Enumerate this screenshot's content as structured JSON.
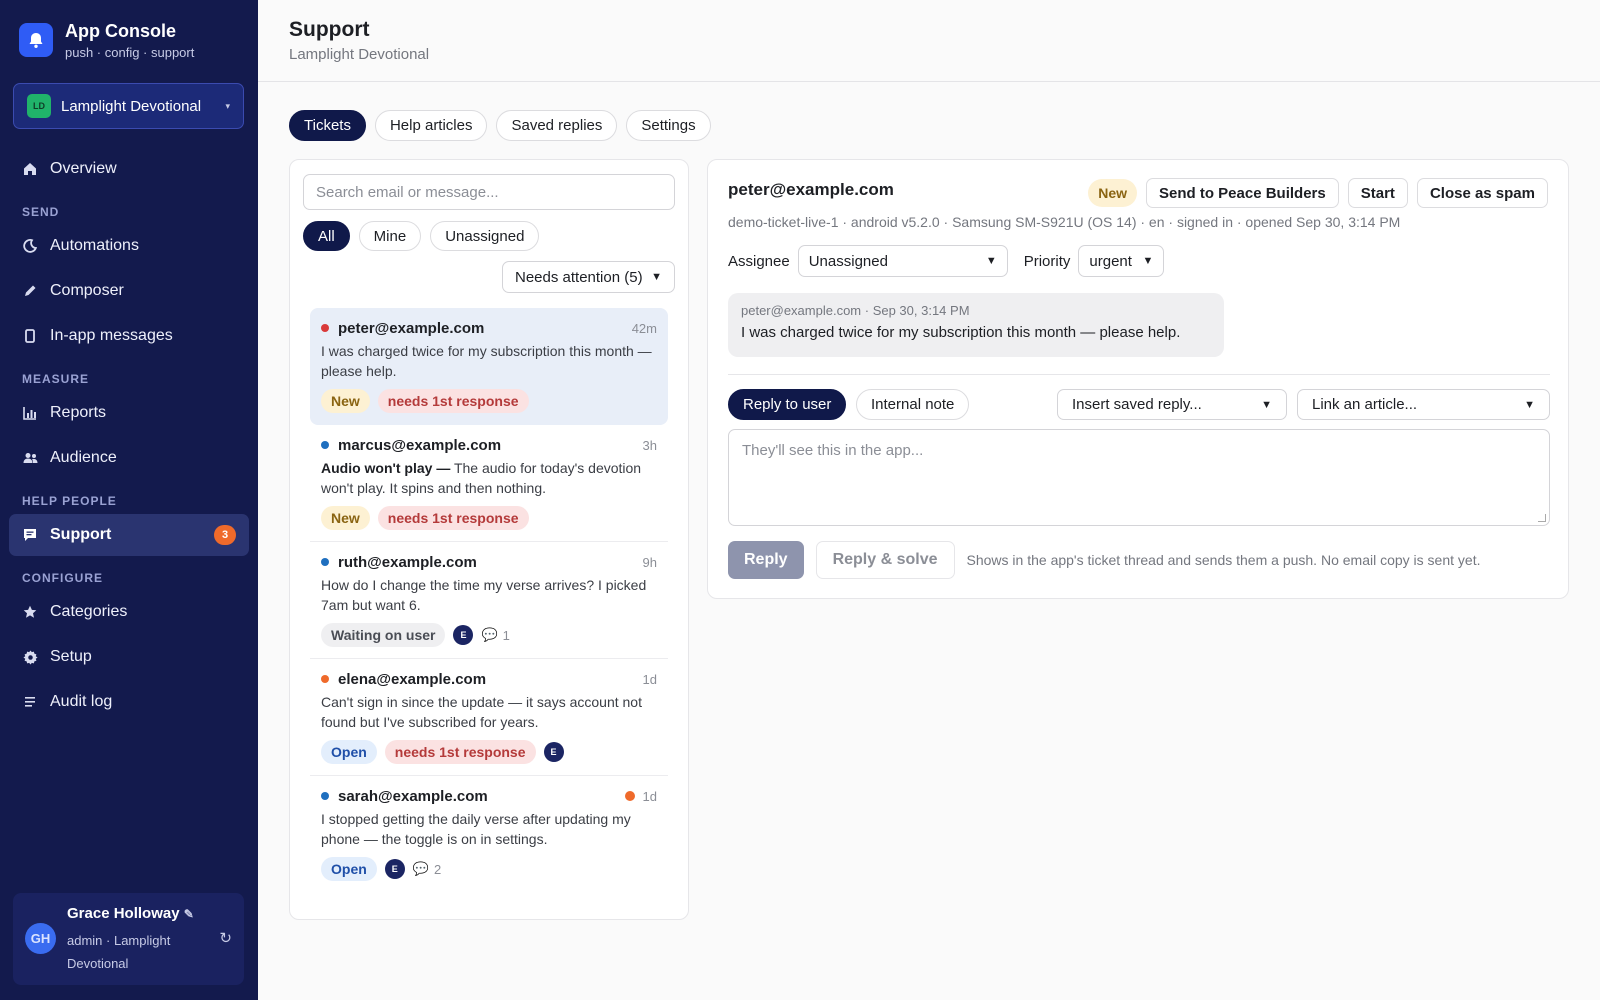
{
  "brand": {
    "title": "App Console",
    "subtitle": "push · config · support"
  },
  "app_switcher": {
    "badge": "LD",
    "name": "Lamplight Devotional"
  },
  "nav": {
    "overview": "Overview",
    "send_header": "SEND",
    "automations": "Automations",
    "composer": "Composer",
    "inapp": "In-app messages",
    "measure_header": "MEASURE",
    "reports": "Reports",
    "audience": "Audience",
    "help_header": "HELP PEOPLE",
    "support": "Support",
    "support_count": "3",
    "configure_header": "CONFIGURE",
    "categories": "Categories",
    "setup": "Setup",
    "audit": "Audit log"
  },
  "user": {
    "initials": "GH",
    "name": "Grace Holloway",
    "role": "admin · Lamplight Devotional"
  },
  "header": {
    "title": "Support",
    "subtitle": "Lamplight Devotional"
  },
  "tabs": [
    "Tickets",
    "Help articles",
    "Saved replies",
    "Settings"
  ],
  "list": {
    "search_placeholder": "Search email or message...",
    "filters": [
      "All",
      "Mine",
      "Unassigned"
    ],
    "attention_select": "Needs attention (5)",
    "tickets": [
      {
        "email": "peter@example.com",
        "time": "42m",
        "dot": "#d93a3a",
        "msg": "I was charged twice for my subscription this month — please help.",
        "tag1": "New",
        "tag2": "needs 1st response"
      },
      {
        "email": "marcus@example.com",
        "time": "3h",
        "dot": "#1f6fbf",
        "subject": "Audio won't play —",
        "msg": " The audio for today's devotion won't play. It spins and then nothing.",
        "tag1": "New",
        "tag2": "needs 1st response"
      },
      {
        "email": "ruth@example.com",
        "time": "9h",
        "dot": "#1f6fbf",
        "msg": "How do I change the time my verse arrives? I picked 7am but want 6.",
        "tag1": "Waiting on user",
        "assignee": "E",
        "comments": "1"
      },
      {
        "email": "elena@example.com",
        "time": "1d",
        "dot": "#ef6a2b",
        "msg": "Can't sign in since the update — it says account not found but I've subscribed for years.",
        "tag1": "Open",
        "tag2": "needs 1st response",
        "assignee": "E"
      },
      {
        "email": "sarah@example.com",
        "time": "1d",
        "dot": "#1f6fbf",
        "msg": "I stopped getting the daily verse after updating my phone — the toggle is on in settings.",
        "tag1": "Open",
        "assignee": "E",
        "comments": "2"
      }
    ]
  },
  "detail": {
    "email": "peter@example.com",
    "status": "New",
    "actions": [
      "Send to Peace Builders",
      "Start",
      "Close as spam"
    ],
    "meta": "demo-ticket-live-1 · android v5.2.0 · Samsung SM-S921U (OS 14) · en · signed in · opened Sep 30, 3:14 PM",
    "assignee_label": "Assignee",
    "assignee_value": "Unassigned",
    "priority_label": "Priority",
    "priority_value": "urgent",
    "message_meta": "peter@example.com · Sep 30, 3:14 PM",
    "message_text": "I was charged twice for my subscription this month — please help.",
    "modes": [
      "Reply to user",
      "Internal note"
    ],
    "saved_reply_select": "Insert saved reply...",
    "article_select": "Link an article...",
    "reply_placeholder": "They'll see this in the app...",
    "reply_btn": "Reply",
    "solve_btn": "Reply & solve",
    "footnote": "Shows in the app's ticket thread and sends them a push. No email copy is sent yet."
  }
}
